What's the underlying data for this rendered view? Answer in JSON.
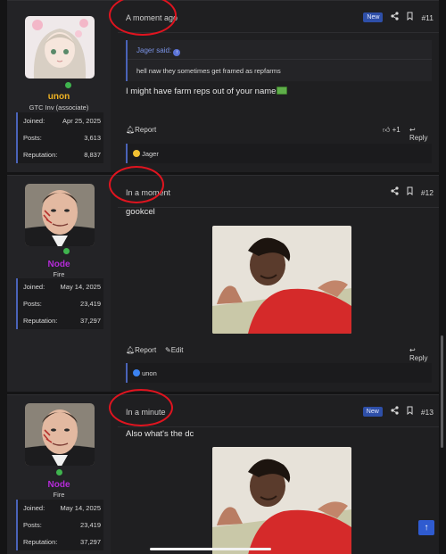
{
  "posts": [
    {
      "timestamp": "A moment ago",
      "badge": "New",
      "post_number": "#11",
      "username": "unon",
      "username_color": "#f0b323",
      "user_title": "GTC Inv (associate)",
      "stats": [
        {
          "label": "Joined:",
          "value": "Apr 25, 2025"
        },
        {
          "label": "Posts:",
          "value": "3,613"
        },
        {
          "label": "Reputation:",
          "value": "8,837"
        }
      ],
      "quote": {
        "author": "Jager said:",
        "text": "hell naw they sometimes get framed as repfarms"
      },
      "body": "I might have farm reps out of your name",
      "actions": {
        "report": "Report",
        "like_count": "+1",
        "reply": "Reply"
      },
      "reactions": "Jager"
    },
    {
      "timestamp": "In a moment",
      "post_number": "#12",
      "username": "Node",
      "username_color": "#b42bd8",
      "user_title": "Fire",
      "stats": [
        {
          "label": "Joined:",
          "value": "May 14, 2025"
        },
        {
          "label": "Posts:",
          "value": "23,419"
        },
        {
          "label": "Reputation:",
          "value": "37,297"
        }
      ],
      "body": "gookcel",
      "actions": {
        "report": "Report",
        "edit": "Edit",
        "reply": "Reply"
      },
      "reactions": "unon"
    },
    {
      "timestamp": "In a minute",
      "badge": "New",
      "post_number": "#13",
      "username": "Node",
      "username_color": "#b42bd8",
      "user_title": "Fire",
      "stats": [
        {
          "label": "Joined:",
          "value": "May 14, 2025"
        },
        {
          "label": "Posts:",
          "value": "23,419"
        },
        {
          "label": "Reputation:",
          "value": "37,297"
        }
      ],
      "body": "Also what's the dc"
    }
  ],
  "colors": {
    "accent": "#4a63b8",
    "annotation": "#e0141f",
    "online": "#3fb44e"
  }
}
